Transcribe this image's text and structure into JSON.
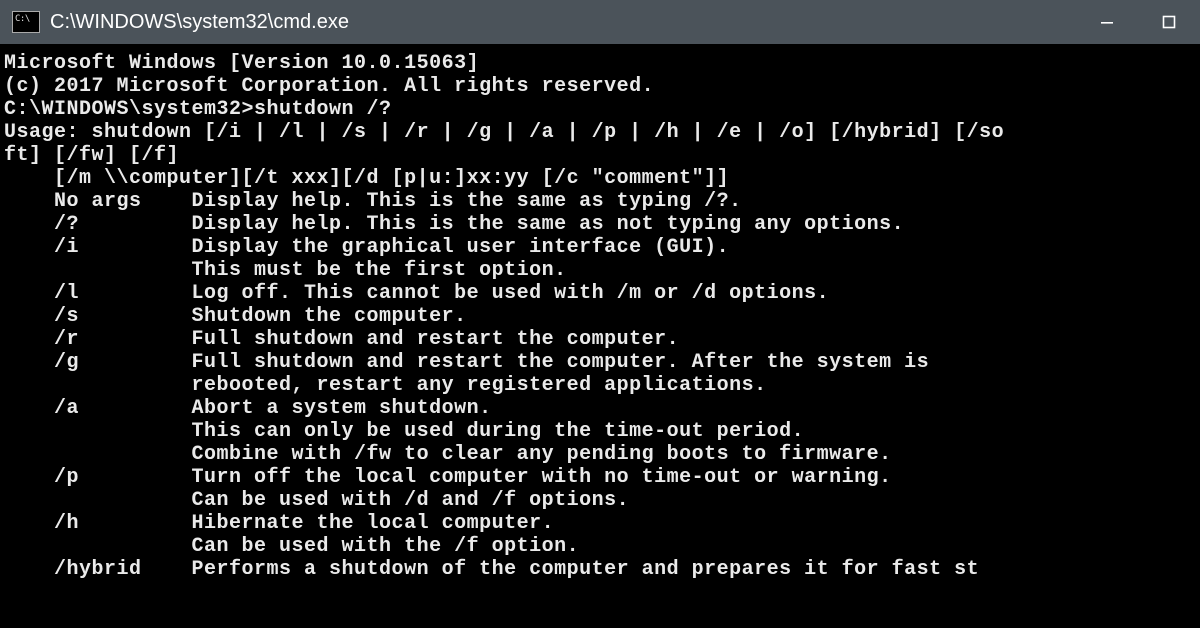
{
  "titlebar": {
    "title": "C:\\WINDOWS\\system32\\cmd.exe"
  },
  "terminal": {
    "lines": [
      "Microsoft Windows [Version 10.0.15063]",
      "(c) 2017 Microsoft Corporation. All rights reserved.",
      "",
      "C:\\WINDOWS\\system32>shutdown /?",
      "Usage: shutdown [/i | /l | /s | /r | /g | /a | /p | /h | /e | /o] [/hybrid] [/so",
      "ft] [/fw] [/f]",
      "    [/m \\\\computer][/t xxx][/d [p|u:]xx:yy [/c \"comment\"]]",
      "",
      "    No args    Display help. This is the same as typing /?.",
      "    /?         Display help. This is the same as not typing any options.",
      "    /i         Display the graphical user interface (GUI).",
      "               This must be the first option.",
      "    /l         Log off. This cannot be used with /m or /d options.",
      "    /s         Shutdown the computer.",
      "    /r         Full shutdown and restart the computer.",
      "    /g         Full shutdown and restart the computer. After the system is",
      "               rebooted, restart any registered applications.",
      "    /a         Abort a system shutdown.",
      "               This can only be used during the time-out period.",
      "               Combine with /fw to clear any pending boots to firmware.",
      "    /p         Turn off the local computer with no time-out or warning.",
      "               Can be used with /d and /f options.",
      "    /h         Hibernate the local computer.",
      "               Can be used with the /f option.",
      "    /hybrid    Performs a shutdown of the computer and prepares it for fast st"
    ]
  }
}
